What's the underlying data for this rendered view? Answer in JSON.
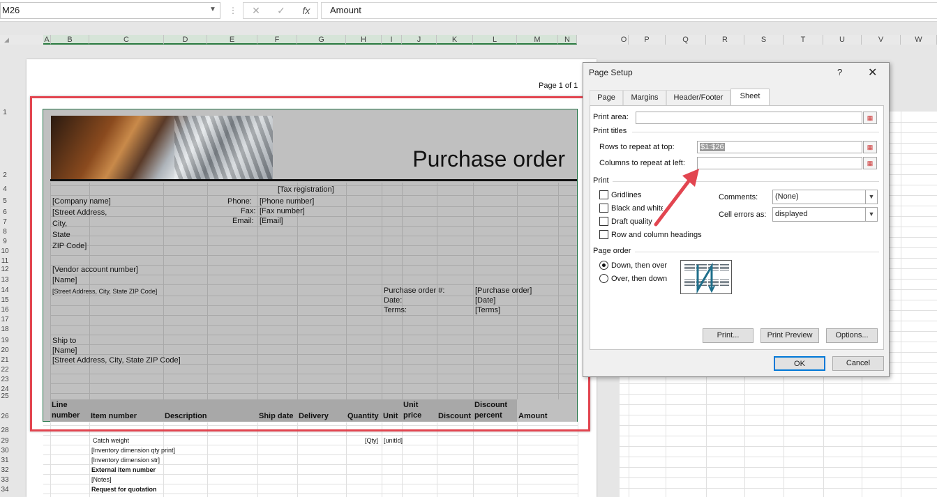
{
  "formula_bar": {
    "name_box": "M26",
    "cancel_icon": "✕",
    "enter_icon": "✓",
    "fx": "fx",
    "formula": "Amount"
  },
  "column_headers_left": [
    "A",
    "B",
    "C",
    "D",
    "E",
    "F",
    "G",
    "H",
    "I",
    "J",
    "K",
    "L",
    "M",
    "N"
  ],
  "column_headers_right": [
    "O",
    "P",
    "Q",
    "R",
    "S",
    "T",
    "U",
    "V",
    "W"
  ],
  "page_label": "Page 1 of 1",
  "sheet": {
    "title": "Purchase order",
    "tax_registration": "[Tax registration]",
    "company_name": "[Company name]",
    "street_address": "[Street Address,",
    "city": "City,",
    "state": "State",
    "zip": "ZIP Code]",
    "phone_label": "Phone:",
    "phone_value": "[Phone number]",
    "fax_label": "Fax:",
    "fax_value": "[Fax number]",
    "email_label": "Email:",
    "email_value": "[Email]",
    "vendor_account": "[Vendor account number]",
    "name": "[Name]",
    "vendor_address": "[Street Address, City, State ZIP Code]",
    "po_label": "Purchase order #:",
    "po_value": "[Purchase order]",
    "date_label": "Date:",
    "date_value": "[Date]",
    "terms_label": "Terms:",
    "terms_value": "[Terms]",
    "ship_to": "Ship to",
    "ship_name": "[Name]",
    "ship_address": "[Street Address, City, State ZIP Code]",
    "headers": {
      "line_number_1": "Line",
      "line_number_2": "number",
      "item_number": "Item number",
      "description": "Description",
      "ship_date": "Ship date",
      "delivery": "Delivery",
      "quantity": "Quantity",
      "unit": "Unit",
      "unit_price_1": "Unit",
      "unit_price_2": "price",
      "discount": "Discount",
      "discount_percent_1": "Discount",
      "discount_percent_2": "percent",
      "amount": "Amount"
    },
    "lower_rows": {
      "catch_weight": "Catch weight",
      "qty": "[Qty]",
      "unitid": "[unitId]",
      "inv_qty_print": "[Inventory dimension qty print]",
      "inv_str": "[Inventory dimension str]",
      "external_item": "External item number",
      "notes": "[Notes]",
      "rfq": "Request for quotation"
    }
  },
  "row_numbers": [
    "1",
    "2",
    "4",
    "5",
    "6",
    "7",
    "8",
    "9",
    "10",
    "11",
    "12",
    "13",
    "14",
    "15",
    "16",
    "17",
    "18",
    "19",
    "20",
    "21",
    "22",
    "23",
    "24",
    "25",
    "26",
    "28",
    "29",
    "30",
    "31",
    "32",
    "33",
    "34"
  ],
  "dialog": {
    "title": "Page Setup",
    "help": "?",
    "close": "✕",
    "tabs": [
      "Page",
      "Margins",
      "Header/Footer",
      "Sheet"
    ],
    "print_area_label": "Print area:",
    "print_area_value": "",
    "print_titles_label": "Print titles",
    "rows_repeat_label": "Rows to repeat at top:",
    "rows_repeat_value": "$1:$26",
    "cols_repeat_label": "Columns to repeat at left:",
    "cols_repeat_value": "",
    "print_label": "Print",
    "gridlines": "Gridlines",
    "black_white": "Black and white",
    "draft_quality": "Draft quality",
    "row_col_headings": "Row and column headings",
    "comments_label": "Comments:",
    "comments_value": "(None)",
    "cell_errors_label": "Cell errors as:",
    "cell_errors_value": "displayed",
    "page_order_label": "Page order",
    "down_then_over": "Down, then over",
    "over_then_down": "Over, then down",
    "print_btn": "Print...",
    "preview_btn": "Print Preview",
    "options_btn": "Options...",
    "ok_btn": "OK",
    "cancel_btn": "Cancel",
    "range_icon": "range-select-icon"
  },
  "colors": {
    "annotation_red": "#e24550",
    "excel_green": "#217346",
    "focus_blue": "#0078d7"
  }
}
